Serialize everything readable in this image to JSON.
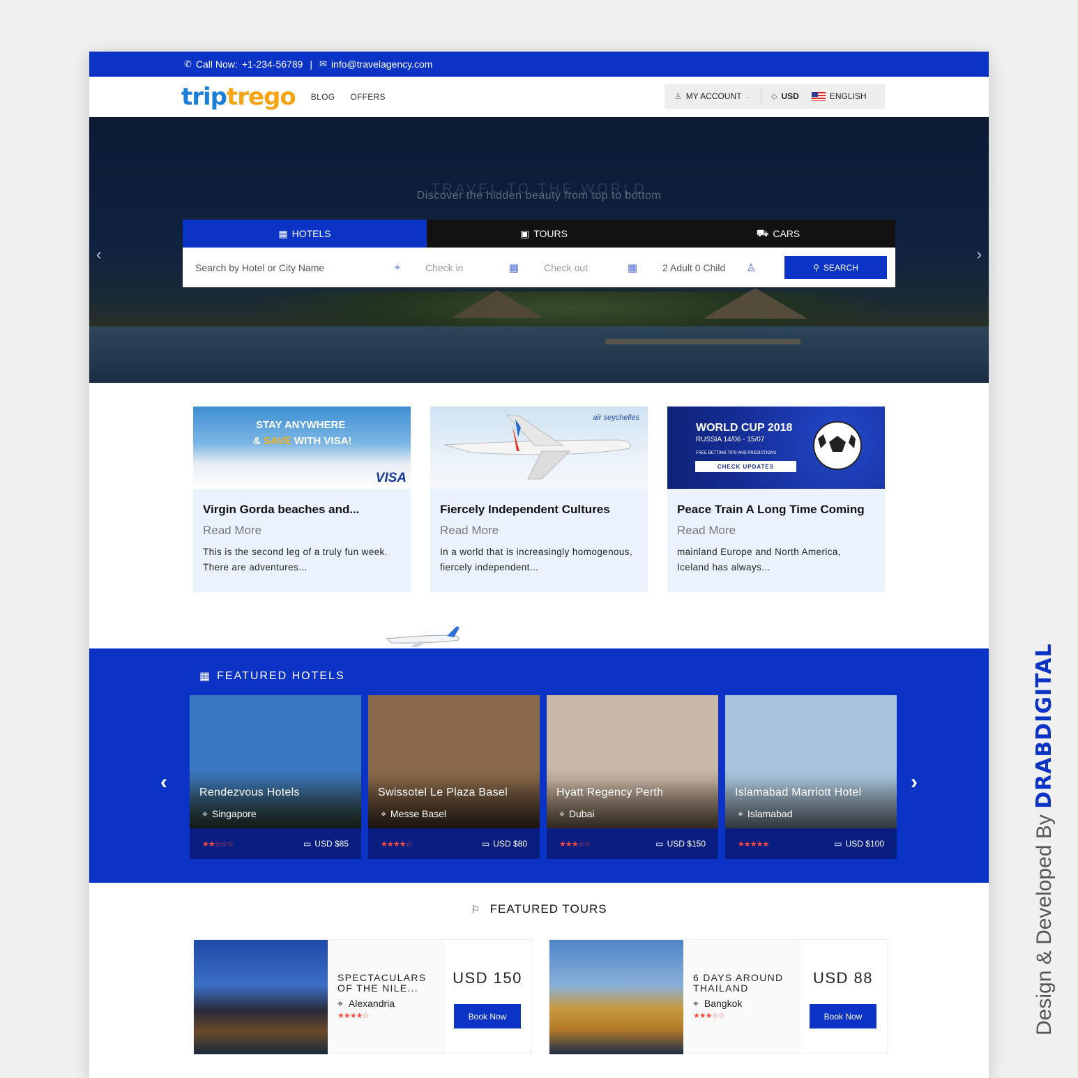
{
  "topbar": {
    "call_label": "Call Now:",
    "phone": "+1-234-56789",
    "separator": "|",
    "email": "info@travelagency.com"
  },
  "header": {
    "logo_part1": "trip",
    "logo_part2": "trego",
    "nav": [
      "BLOG",
      "OFFERS"
    ],
    "account": "MY ACCOUNT",
    "currency": "USD",
    "language": "ENGLISH"
  },
  "hero": {
    "title": "TRAVEL TO THE WORLD",
    "subtitle": "Discover the hidden beauty from top to bottom",
    "tabs": [
      "HOTELS",
      "TOURS",
      "CARS"
    ],
    "search_placeholder": "Search by Hotel or City Name",
    "checkin": "Check in",
    "checkout": "Check out",
    "guests": "2 Adult 0 Child",
    "search_button": "SEARCH"
  },
  "promos": [
    {
      "banner_line1": "STAY ANYWHERE",
      "banner_and": "&",
      "banner_save": "SAVE",
      "banner_line2": "WITH VISA!",
      "banner_brand": "VISA",
      "title": "Virgin Gorda beaches and...",
      "read_more": "Read More",
      "text": "This is the second leg of a truly fun week. There are adventures..."
    },
    {
      "banner_brand": "air seychelles",
      "title": "Fiercely Independent Cultures",
      "read_more": "Read More",
      "text": "In a world that is increasingly homogenous, fiercely independent..."
    },
    {
      "banner_line1": "WORLD CUP 2018",
      "banner_line2": "RUSSIA 14/06 - 15/07",
      "banner_line3": "FREE BETTING TIPS AND PREDICTIONS",
      "banner_cta": "CHECK UPDATES",
      "title": "Peace Train A Long Time Coming",
      "read_more": "Read More",
      "text": " mainland Europe and North America, Iceland has always..."
    }
  ],
  "featured_hotels": {
    "title": "FEATURED HOTELS",
    "items": [
      {
        "name": "Rendezvous Hotels",
        "location": "Singapore",
        "rating": 2,
        "price": "USD $85",
        "sky": "#3a78c2",
        "ground": "#2b3a2c"
      },
      {
        "name": "Swissotel Le Plaza Basel",
        "location": "Messe Basel",
        "rating": 4,
        "price": "USD $80",
        "sky": "#8a6a4a",
        "ground": "#3e2e22"
      },
      {
        "name": "Hyatt Regency Perth",
        "location": "Dubai",
        "rating": 3,
        "price": "USD $150",
        "sky": "#c8b8a8",
        "ground": "#6e5a48"
      },
      {
        "name": "Islamabad Marriott Hotel",
        "location": "Islamabad",
        "rating": 5,
        "price": "USD $100",
        "sky": "#a8c4dc",
        "ground": "#6f7d88"
      }
    ]
  },
  "featured_tours": {
    "title": "FEATURED TOURS",
    "items": [
      {
        "name": "SPECTACULARS OF THE NILE...",
        "location": "Alexandria",
        "rating": 4,
        "price": "USD 150",
        "button": "Book Now"
      },
      {
        "name": "6 DAYS AROUND THAILAND",
        "location": "Bangkok",
        "rating": 3,
        "price": "USD 88",
        "button": "Book Now"
      }
    ]
  },
  "credit": {
    "prefix": "Design & Developed By ",
    "brand": "DRABDIGITAL"
  },
  "colors": {
    "primary": "#0b33c6",
    "star": "#ff4a3a",
    "logo_blue": "#1b7fd8",
    "logo_orange": "#f6a314"
  }
}
